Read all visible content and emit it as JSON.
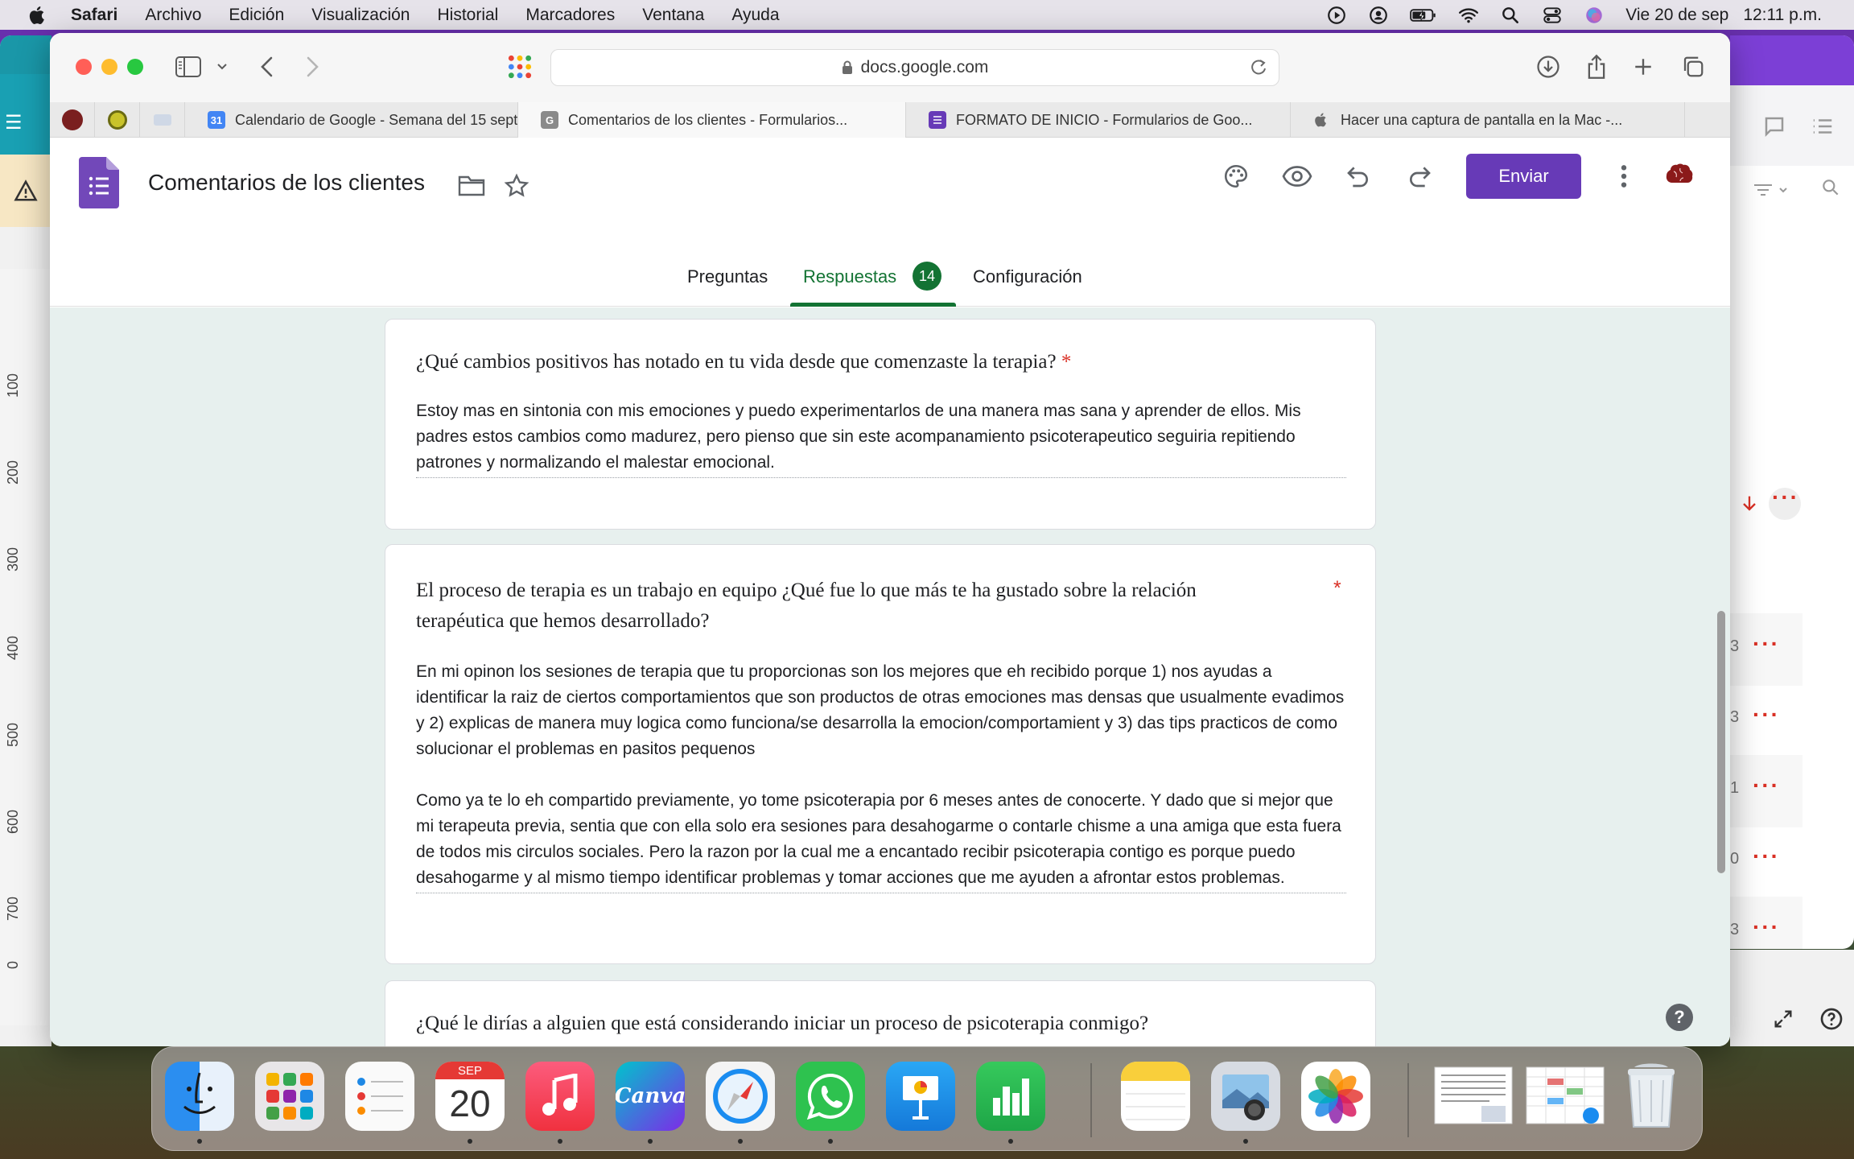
{
  "menubar": {
    "app": "Safari",
    "menus": [
      "Archivo",
      "Edición",
      "Visualización",
      "Historial",
      "Marcadores",
      "Ventana",
      "Ayuda"
    ],
    "date": "Vie 20 de sep",
    "time": "12:11 p.m."
  },
  "browser": {
    "url": "docs.google.com",
    "tabs": [
      {
        "title": "Calendario de Google - Semana del 15 sept...",
        "icon": "calendar-icon",
        "active": false
      },
      {
        "title": "Comentarios de los clientes - Formularios...",
        "icon": "google-g-icon",
        "active": true
      },
      {
        "title": "FORMATO DE INICIO - Formularios de Goo...",
        "icon": "forms-icon",
        "active": false
      },
      {
        "title": "Hacer una captura de pantalla en la Mac -...",
        "icon": "apple-icon",
        "active": false
      }
    ],
    "calendar_day": "31"
  },
  "form": {
    "title": "Comentarios de los clientes",
    "send_label": "Enviar",
    "tabs": {
      "questions": "Preguntas",
      "responses": "Respuestas",
      "responses_count": "14",
      "settings": "Configuración"
    },
    "accent": "#673ab7",
    "active_tab_color": "#137333"
  },
  "questions": [
    {
      "title": "¿Qué cambios positivos has notado en tu vida desde que comenzaste la terapia?",
      "required": "*",
      "answer": [
        "Estoy mas en sintonia con mis emociones y puedo experimentarlos de una manera mas sana y aprender de ellos. Mis padres estos cambios como madurez, pero pienso que sin este acompanamiento psicoterapeutico seguiria repitiendo patrones y normalizando el malestar emocional."
      ]
    },
    {
      "title_line1": "El proceso de terapia es un trabajo en equipo ¿Qué fue lo que más te ha gustado sobre la relación",
      "title_line2": "terapéutica que hemos desarrollado?",
      "required": "*",
      "answer": [
        "En mi opinon los sesiones de terapia que tu proporcionas son los mejores que eh recibido porque 1) nos ayudas a identificar la raiz de ciertos comportamientos que son productos de otras emociones mas densas que usualmente evadimos y 2) explicas de manera muy logica como funciona/se desarrolla la emocion/comportamient y 3) das tips practicos de como solucionar el problemas en pasitos pequenos",
        "Como ya te lo eh compartido previamente, yo tome psicoterapia por 6 meses antes de conocerte. Y dado que si mejor que mi terapeuta previa, sentia que con ella solo era sesiones para desahogarme o contarle chisme a una amiga que esta fuera de todos mis circulos sociales. Pero la razon por la cual me a encantado recibir psicoterapia contigo es porque puedo desahogarme y al mismo tiempo identificar problemas y tomar acciones que me ayuden a afrontar estos problemas."
      ]
    },
    {
      "title": "¿Qué le dirías a alguien que está considerando iniciar un proceso de psicoterapia conmigo?"
    }
  ],
  "left_ruler": [
    "100",
    "200",
    "300",
    "400",
    "500",
    "600",
    "700",
    "0"
  ],
  "right_window_numbers": [
    "3",
    "3",
    "1",
    "0",
    "3"
  ],
  "dock": {
    "calendar_month": "SEP",
    "calendar_day": "20",
    "canva_label": "Canva",
    "apps": [
      "finder-icon",
      "launchpad-icon",
      "reminders-icon",
      "calendar-icon",
      "music-icon",
      "canva-icon",
      "safari-icon",
      "whatsapp-icon",
      "keynote-icon",
      "numbers-icon",
      "notes-icon",
      "preview-icon",
      "photos-icon",
      "document-thumbnail",
      "spreadsheet-thumbnail",
      "trash-icon"
    ]
  }
}
